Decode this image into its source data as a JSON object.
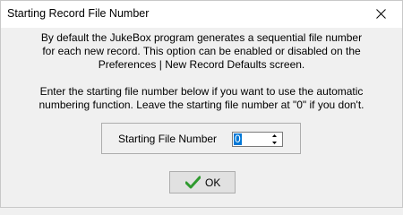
{
  "window": {
    "title": "Starting Record File Number"
  },
  "message": {
    "paragraph1": [
      "By default the JukeBox program generates a sequential file number",
      "for each new record. This option can be enabled or disabled on the",
      "Preferences | New Record Defaults screen."
    ],
    "paragraph2": [
      "Enter the starting file number below if you want to use the automatic",
      "numbering function.  Leave the starting file number at \"0\" if you don't."
    ]
  },
  "field": {
    "label": "Starting File Number",
    "value": "0"
  },
  "buttons": {
    "ok_label": "OK"
  },
  "colors": {
    "selection": "#0078d7",
    "check_green": "#2f9a2f"
  }
}
